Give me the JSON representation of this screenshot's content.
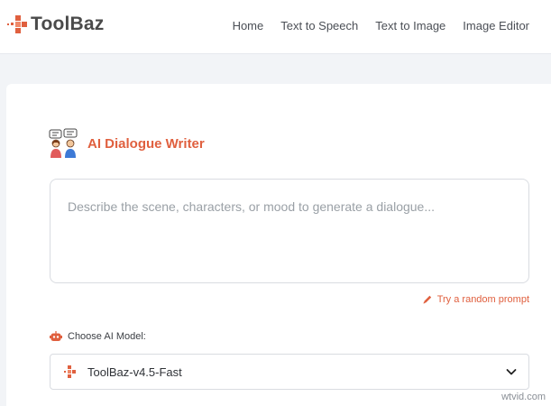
{
  "header": {
    "logo_text": "ToolBaz",
    "nav": [
      {
        "label": "Home"
      },
      {
        "label": "Text to Speech"
      },
      {
        "label": "Text to Image"
      },
      {
        "label": "Image Editor"
      }
    ]
  },
  "tool": {
    "title": "AI Dialogue Writer",
    "prompt_placeholder": "Describe the scene, characters, or mood to generate a dialogue...",
    "prompt_value": "",
    "random_prompt_label": "Try a random prompt",
    "model_label": "Choose AI Model:",
    "model_selected": "ToolBaz-v4.5-Fast"
  },
  "watermark": "wtvid.com",
  "colors": {
    "accent": "#e0603f",
    "text": "#4b4f56",
    "border": "#d9dce1",
    "page_bg": "#f2f4f7"
  },
  "icons": {
    "logo": "toolbaz-logo-icon",
    "title": "dialogue-people-icon",
    "random": "pencil-icon",
    "model_label": "robot-icon",
    "model_option": "toolbaz-mark-icon",
    "dropdown": "chevron-down-icon"
  }
}
